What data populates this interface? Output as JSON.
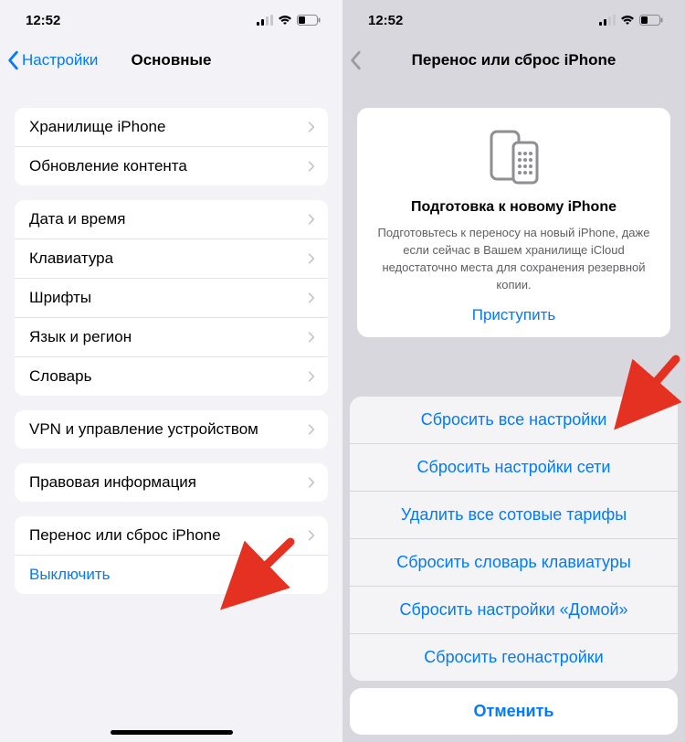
{
  "left": {
    "status_time": "12:52",
    "back_label": "Настройки",
    "title": "Основные",
    "groups": [
      {
        "rows": [
          {
            "label": "Хранилище iPhone",
            "chevron": true
          },
          {
            "label": "Обновление контента",
            "chevron": true
          }
        ]
      },
      {
        "rows": [
          {
            "label": "Дата и время",
            "chevron": true
          },
          {
            "label": "Клавиатура",
            "chevron": true
          },
          {
            "label": "Шрифты",
            "chevron": true
          },
          {
            "label": "Язык и регион",
            "chevron": true
          },
          {
            "label": "Словарь",
            "chevron": true
          }
        ]
      },
      {
        "rows": [
          {
            "label": "VPN и управление устройством",
            "chevron": true
          }
        ]
      },
      {
        "rows": [
          {
            "label": "Правовая информация",
            "chevron": true
          }
        ]
      },
      {
        "rows": [
          {
            "label": "Перенос или сброс iPhone",
            "chevron": true
          },
          {
            "label": "Выключить",
            "chevron": false,
            "blue": true
          }
        ]
      }
    ]
  },
  "right": {
    "status_time": "12:52",
    "title": "Перенос или сброс iPhone",
    "card": {
      "heading": "Подготовка к новому iPhone",
      "body": "Подготовьтесь к переносу на новый iPhone, даже если сейчас в Вашем хранилище iCloud недостаточно места для сохранения резервной копии.",
      "link": "Приступить"
    },
    "sheet": [
      "Сбросить все настройки",
      "Сбросить настройки сети",
      "Удалить все сотовые тарифы",
      "Сбросить словарь клавиатуры",
      "Сбросить настройки «Домой»",
      "Сбросить геонастройки"
    ],
    "cancel": "Отменить"
  }
}
